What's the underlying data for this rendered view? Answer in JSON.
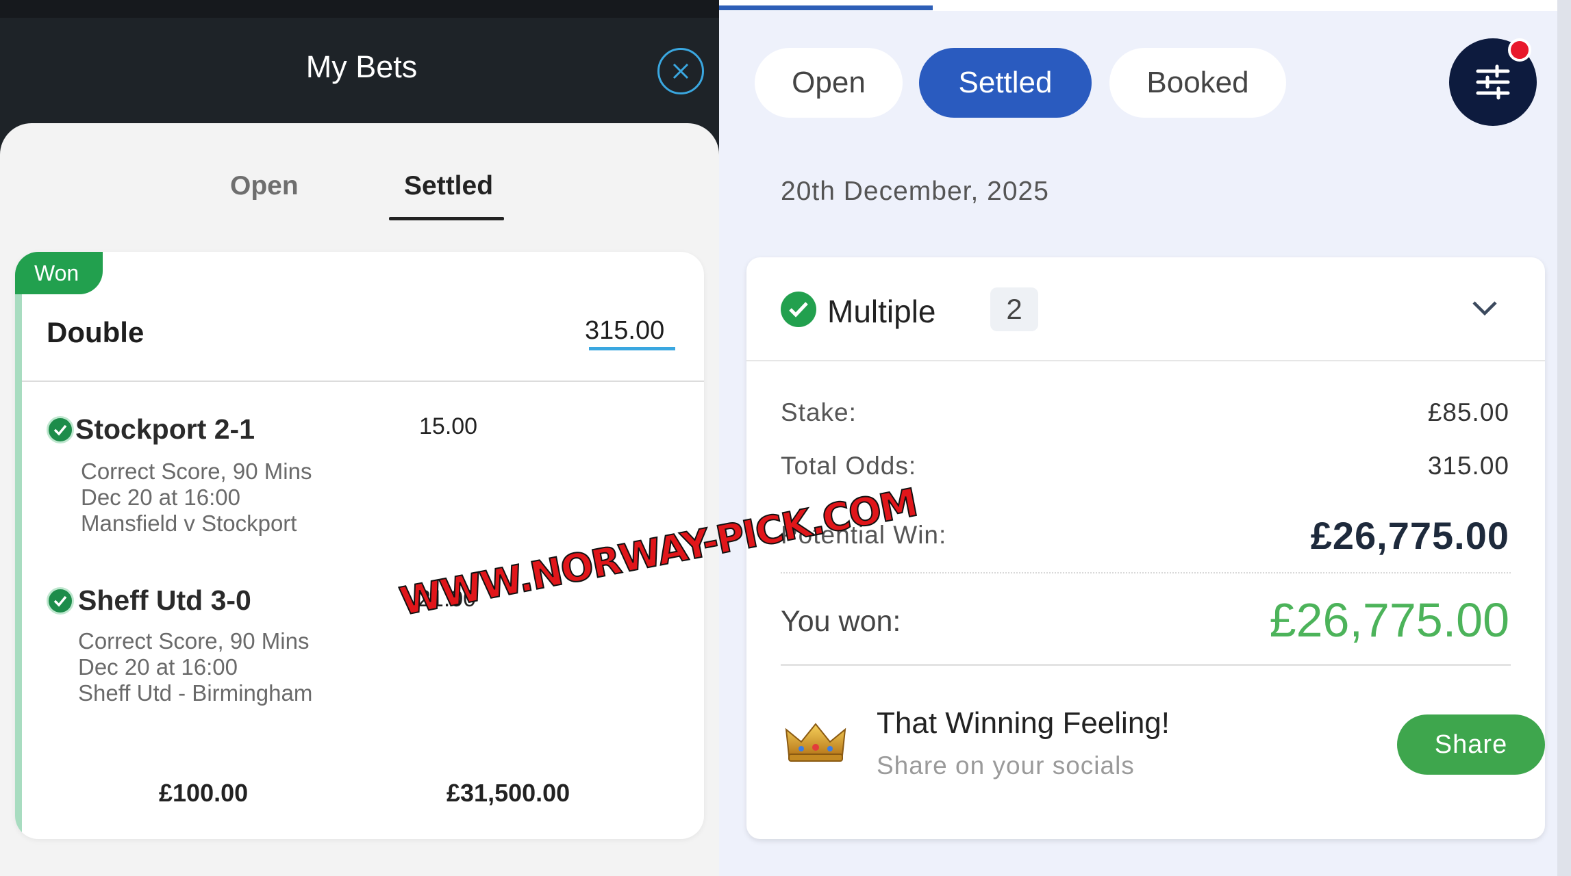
{
  "left": {
    "title": "My Bets",
    "tabs": {
      "open": "Open",
      "settled": "Settled"
    },
    "bet": {
      "status": "Won",
      "type": "Double",
      "total_odds": "315.00",
      "selections": [
        {
          "title": "Stockport 2-1",
          "odds": "15.00",
          "market": "Correct Score, 90 Mins",
          "date": "Dec 20 at 16:00",
          "event": "Mansfield v Stockport"
        },
        {
          "title": "Sheff Utd 3-0",
          "odds": "21.00",
          "market": "Correct Score, 90 Mins",
          "date": "Dec 20 at 16:00",
          "event": "Sheff Utd - Birmingham"
        }
      ],
      "stake": "£100.00",
      "returns": "£31,500.00"
    }
  },
  "watermark": "WWW.NORWAY-PICK.COM",
  "right": {
    "tabs": {
      "open": "Open",
      "settled": "Settled",
      "booked": "Booked"
    },
    "date": "20th December, 2025",
    "bet": {
      "type": "Multiple",
      "count": "2",
      "stake_label": "Stake:",
      "stake": "£85.00",
      "odds_label": "Total Odds:",
      "odds": "315.00",
      "potential_label": "Potential Win:",
      "potential": "£26,775.00",
      "won_label": "You won:",
      "won": "£26,775.00"
    },
    "share": {
      "title": "That Winning Feeling!",
      "subtitle": "Share on your socials",
      "button": "Share"
    }
  },
  "colors": {
    "won_green": "#22a04e",
    "accent_blue": "#2a5bbf",
    "link_blue": "#3aa7e0",
    "win_amount_green": "#4cb35a",
    "notification_red": "#e8192c"
  },
  "icons": [
    "close-icon",
    "check-icon",
    "filter-icon",
    "chevron-down-icon",
    "crown-icon"
  ]
}
